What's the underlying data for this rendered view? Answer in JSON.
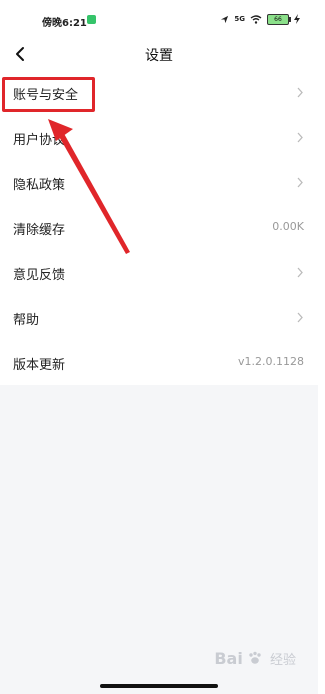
{
  "status": {
    "time": "傍晚6:21",
    "battery": "66",
    "signal_label": "5G"
  },
  "nav": {
    "title": "设置"
  },
  "menu": {
    "items": [
      {
        "label": "账号与安全",
        "value": "",
        "has_chevron": true
      },
      {
        "label": "用户协议",
        "value": "",
        "has_chevron": true
      },
      {
        "label": "隐私政策",
        "value": "",
        "has_chevron": true
      },
      {
        "label": "清除缓存",
        "value": "0.00K",
        "has_chevron": false
      },
      {
        "label": "意见反馈",
        "value": "",
        "has_chevron": true
      },
      {
        "label": "帮助",
        "value": "",
        "has_chevron": true
      },
      {
        "label": "版本更新",
        "value": "v1.2.0.1128",
        "has_chevron": false
      }
    ]
  },
  "annotation": {
    "color": "#e0262a"
  },
  "watermark": {
    "brand": "Bai",
    "brand_suffix": "经验"
  }
}
